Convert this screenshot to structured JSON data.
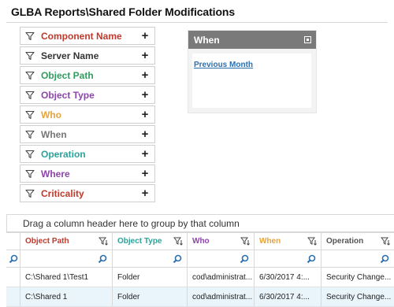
{
  "page": {
    "title": "GLBA Reports\\Shared Folder Modifications"
  },
  "filters": [
    {
      "label": "Component Name",
      "color": "#c0392b"
    },
    {
      "label": "Server Name",
      "color": "#333333"
    },
    {
      "label": "Object Path",
      "color": "#2e9e5e"
    },
    {
      "label": "Object Type",
      "color": "#8e44ad"
    },
    {
      "label": "Who",
      "color": "#e8a33a"
    },
    {
      "label": "When",
      "color": "#777777"
    },
    {
      "label": "Operation",
      "color": "#2aa39a"
    },
    {
      "label": "Where",
      "color": "#8e44ad"
    },
    {
      "label": "Criticality",
      "color": "#c0392b"
    }
  ],
  "when_panel": {
    "header": "When",
    "link": "Previous Month"
  },
  "grid": {
    "group_hint": "Drag a column header here to group by that column",
    "columns": [
      {
        "label": "Object Path",
        "color": "#c0392b"
      },
      {
        "label": "Object Type",
        "color": "#2aa39a"
      },
      {
        "label": "Who",
        "color": "#8e44ad"
      },
      {
        "label": "When",
        "color": "#e8a33a"
      },
      {
        "label": "Operation",
        "color": "#555555"
      }
    ],
    "rows": [
      [
        "C:\\Shared 1\\Test1",
        "Folder",
        "cod\\administrat...",
        "6/30/2017 4:...",
        "Security Change..."
      ],
      [
        "C:\\Shared 1",
        "Folder",
        "cod\\administrat...",
        "6/30/2017 4:...",
        "Security Change..."
      ]
    ]
  },
  "icons": {
    "filter": "funnel-icon",
    "add": "plus-icon",
    "search": "search-icon",
    "minimize": "minimize-icon"
  }
}
